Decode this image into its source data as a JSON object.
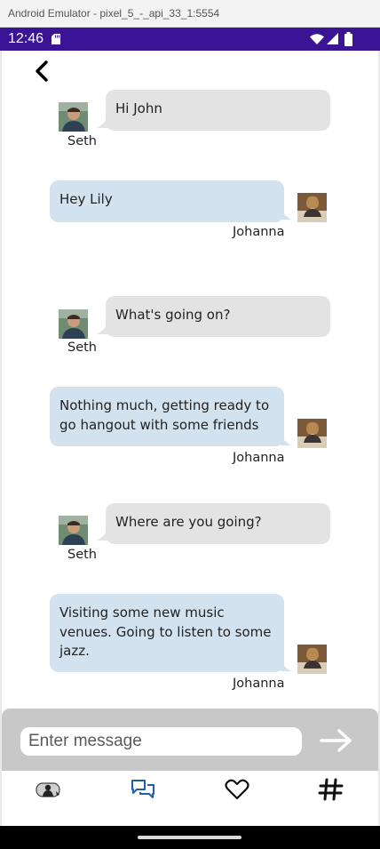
{
  "window": {
    "title": "Android Emulator - pixel_5_-_api_33_1:5554"
  },
  "status_bar": {
    "time": "12:46"
  },
  "messages": [
    {
      "sender": "Seth",
      "text": "Hi John"
    },
    {
      "sender": "Johanna",
      "text": "Hey Lily"
    },
    {
      "sender": "Seth",
      "text": "What's going on?"
    },
    {
      "sender": "Johanna",
      "text": "Nothing much, getting ready to go hangout with some friends"
    },
    {
      "sender": "Seth",
      "text": "Where are you going?"
    },
    {
      "sender": "Johanna",
      "text": "Visiting some new music venues.  Going to listen to some jazz."
    }
  ],
  "composer": {
    "placeholder": "Enter message",
    "value": ""
  },
  "nav": {
    "items": [
      {
        "icon": "profile-icon"
      },
      {
        "icon": "chat-icon",
        "active": true
      },
      {
        "icon": "heart-icon"
      },
      {
        "icon": "hashtag-icon"
      }
    ]
  },
  "colors": {
    "status_bar": "#3a1494",
    "incoming_bubble": "#e3e3e3",
    "outgoing_bubble": "#d3e2ef",
    "active_nav": "#1f5fa8"
  }
}
